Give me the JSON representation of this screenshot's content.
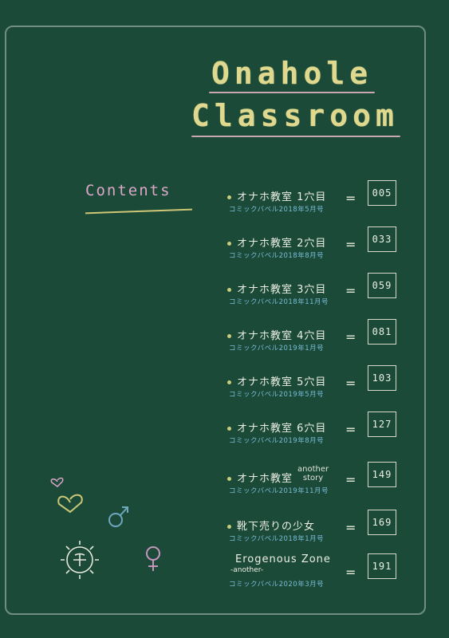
{
  "title": {
    "line1": "Onahole",
    "line2": "Classroom"
  },
  "contents_heading": "Contents",
  "entries": [
    {
      "title": "オナホ教室 1穴目",
      "sub": "コミックバベル2018年5月号",
      "eq": "=",
      "page": "005"
    },
    {
      "title": "オナホ教室 2穴目",
      "sub": "コミックバベル2018年8月号",
      "eq": "=",
      "page": "033"
    },
    {
      "title": "オナホ教室 3穴目",
      "sub": "コミックバベル2018年11月号",
      "eq": "=",
      "page": "059"
    },
    {
      "title": "オナホ教室 4穴目",
      "sub": "コミックバベル2019年1月号",
      "eq": "=",
      "page": "081"
    },
    {
      "title": "オナホ教室 5穴目",
      "sub": "コミックバベル2019年5月号",
      "eq": "=",
      "page": "103"
    },
    {
      "title": "オナホ教室 6穴目",
      "sub": "コミックバベル2019年8月号",
      "eq": "=",
      "page": "127"
    },
    {
      "title": "オナホ教室",
      "side1": "another",
      "side2": "story",
      "sub": "コミックバベル2019年11月号",
      "eq": "=",
      "page": "149"
    },
    {
      "title": "靴下売りの少女",
      "sub": "コミックバベル2018年1月号",
      "eq": "=",
      "page": "169"
    },
    {
      "title": "Erogenous Zone",
      "sub2": "-another-",
      "sub": "コミックバベル2020年3月号",
      "eq": "=",
      "page": "191"
    }
  ],
  "colors": {
    "background": "#1b4a39",
    "title": "#ded98e",
    "contents": "#dba7c7",
    "subtitle": "#79bcd5"
  }
}
